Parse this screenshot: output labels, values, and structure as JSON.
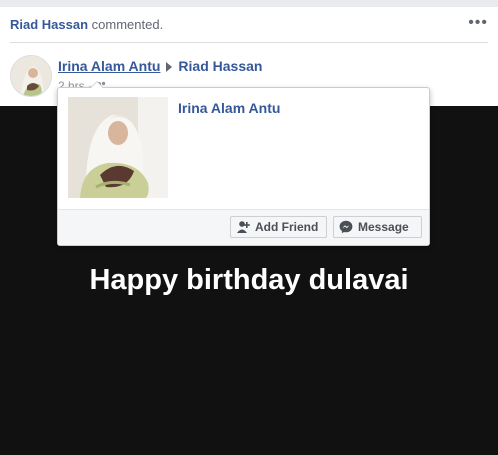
{
  "activity": {
    "actor": "Riad Hassan",
    "action": "commented.",
    "more_label": "•••"
  },
  "post": {
    "author": "Irina Alam Antu",
    "target": "Riad Hassan",
    "time": "2 hrs",
    "separator": "·",
    "audience_icon": "friends-icon",
    "text": "Happy birthday dulavai"
  },
  "hovercard": {
    "name": "Irina Alam Antu",
    "add_friend_label": "Add Friend",
    "message_label": "Message"
  },
  "colors": {
    "link": "#365899",
    "post_background": "#111111",
    "post_text": "#ffffff"
  }
}
